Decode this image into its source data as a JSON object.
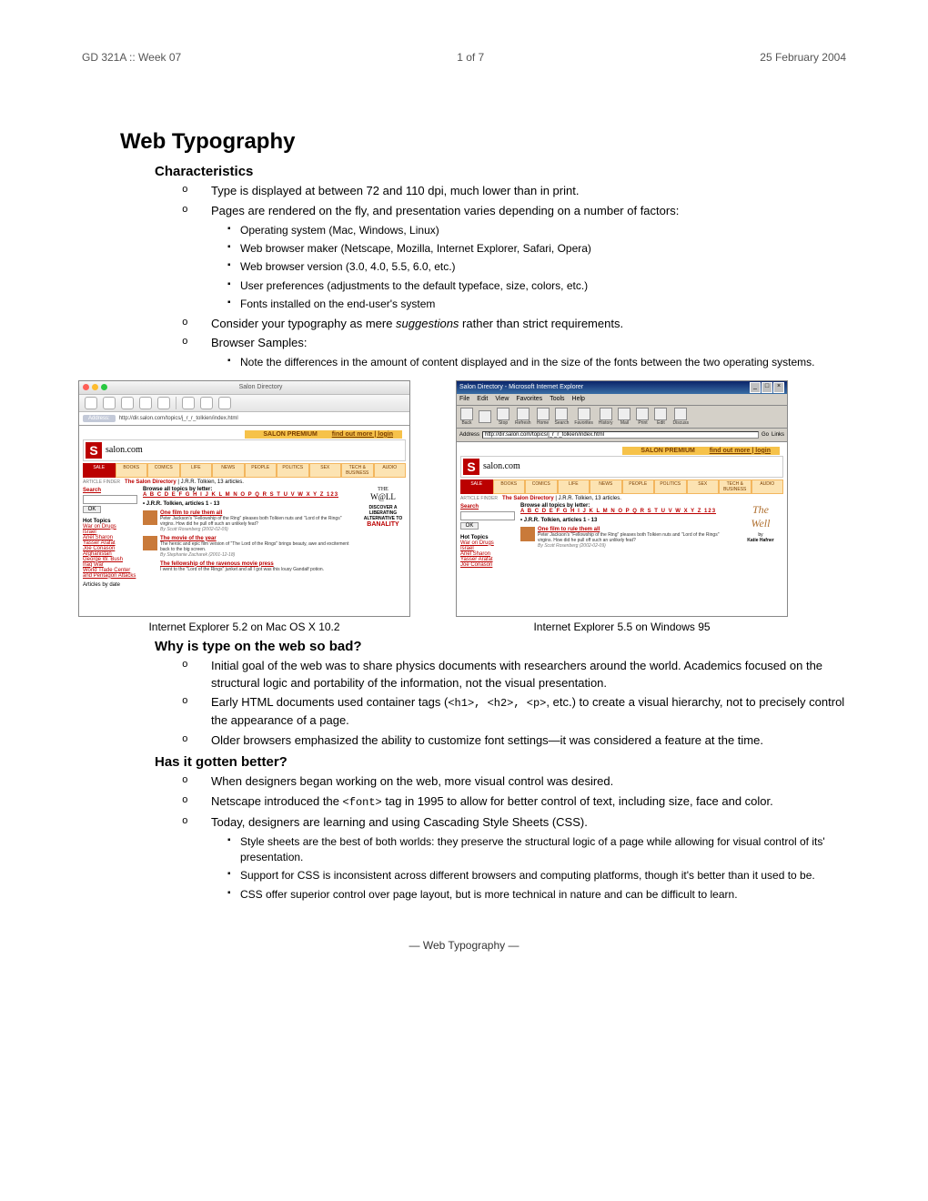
{
  "header": {
    "left": "GD 321A :: Week 07",
    "center": "1 of 7",
    "right": "25 February 2004"
  },
  "title": "Web Typography",
  "sections": {
    "characteristics": {
      "heading": "Characteristics",
      "b1": "Type is displayed at between 72 and 110 dpi, much lower than in print.",
      "b2": "Pages are rendered on the fly, and presentation varies depending on a number of factors:",
      "b2s": {
        "a": "Operating system (Mac, Windows, Linux)",
        "b": "Web browser maker (Netscape, Mozilla, Internet Explorer, Safari, Opera)",
        "c": "Web browser version (3.0, 4.0, 5.5, 6.0, etc.)",
        "d": "User preferences (adjustments to the default typeface, size, colors, etc.)",
        "e": "Fonts installed on the end-user's system"
      },
      "b3a": "Consider your typography as mere ",
      "b3i": "suggestions",
      "b3b": " rather than strict requirements.",
      "b4": "Browser Samples:",
      "b4s": {
        "a": "Note the differences in the amount of content displayed and in the size of the fonts between the two operating systems."
      }
    },
    "screenshots": {
      "left_caption": "Internet Explorer 5.2 on Mac OS X 10.2",
      "right_caption": "Internet Explorer 5.5 on Windows 95",
      "mac": {
        "window_title": "Salon Directory",
        "url": "http://dir.salon.com/topics/j_r_r_tolkien/index.html"
      },
      "win": {
        "window_title": "Salon Directory - Microsoft Internet Explorer",
        "menu": [
          "File",
          "Edit",
          "View",
          "Favorites",
          "Tools",
          "Help"
        ],
        "tool": [
          "Back",
          "",
          "Stop",
          "Refresh",
          "Home",
          "Search",
          "Favorites",
          "History",
          "Mail",
          "Print",
          "Edit",
          "",
          "Discuss"
        ],
        "addr_label": "Address",
        "url": "http://dir.salon.com/topics/j_r_r_tolkien/index.html",
        "go": "Go",
        "links": "Links"
      },
      "salon": {
        "premium": "SALON PREMIUM",
        "premium_link": "find out more | login",
        "brand": "salon.com",
        "tabs": [
          "SALE",
          "BOOKS",
          "COMICS",
          "LIFE",
          "NEWS",
          "PEOPLE",
          "POLITICS",
          "SEX",
          "TECH & BUSINESS",
          "AUDIO"
        ],
        "finder_label": "ARTICLE FINDER",
        "dir_a": "The Salon Directory",
        "dir_b": " | J.R.R. Tolkien, 13 articles.",
        "search": "Search",
        "ok": "OK",
        "hot_h": "Hot Topics",
        "hot": [
          "War on Drugs",
          "Israel",
          "Ariel Sharon",
          "Yasser Arafat",
          "Joe Conason",
          "Afghanistan",
          "George W. Bush",
          "Iraq War",
          "World Trade Center and Pentagon Attacks"
        ],
        "bydate": "Articles by date",
        "browse": "Browse all topics by letter:",
        "alpha": "A B C D E F G H I J K L M N O P Q R S T U V W X Y Z 123",
        "list_h": "• J.R.R. Tolkien, articles 1 - 13",
        "a1_t": "One film to rule them all",
        "a1_d": "Peter Jackson's \"Fellowship of the Ring\" pleases both Tolkien nuts and \"Lord of the Rings\" virgins. How did he pull off such an unlikely feat?",
        "a1_by": "By Scott Rosenberg (2002-02-09)",
        "a2_t": "The movie of the year",
        "a2_d": "The heroic and epic film version of \"The Lord of the Rings\" brings beauty, awe and excitement back to the big screen.",
        "a2_by": "By Stephanie Zacharek (2001-12-18)",
        "a3_t": "The fellowship of the ravenous movie press",
        "a3_d": "I went to the \"Lord of the Rings\" junket and all I got was this lousy Gandalf potion.",
        "well_a": "THE",
        "well_b": "W@LL",
        "well_c": "The",
        "well_d": "Well",
        "well_by": "by",
        "well_name": "Katie Hafner",
        "discover": "DISCOVER A LIBERATING ALTERNATIVE TO",
        "banality": "BANALITY"
      }
    },
    "whybad": {
      "heading": "Why is type on the web so bad?",
      "b1": "Initial goal of the web was to share physics documents with researchers around the world. Academics focused on the structural logic and portability of the information, not the visual presentation.",
      "b2a": "Early HTML documents used container tags (",
      "b2code": "<h1>, <h2>, <p>",
      "b2b": ", etc.) to create a visual hierarchy, not to precisely control the appearance of a page.",
      "b3": "Older browsers emphasized the ability to customize font settings—it was considered a feature at the time."
    },
    "better": {
      "heading": "Has it gotten better?",
      "b1": "When designers began working on the web, more visual control was desired.",
      "b2a": "Netscape introduced the ",
      "b2code": "<font>",
      "b2b": " tag in 1995 to allow for better control of text, including size, face and color.",
      "b3": "Today, designers are learning and using Cascading Style Sheets (CSS).",
      "b3s": {
        "a": "Style sheets are the best of both worlds: they preserve the structural logic of a page while allowing for visual control of its' presentation.",
        "b": "Support for CSS is inconsistent across different browsers and computing platforms, though it's better than it used to be.",
        "c": "CSS offer superior control over page layout, but is more technical in nature and can be difficult to learn."
      }
    }
  },
  "footer": "— Web Typography —"
}
